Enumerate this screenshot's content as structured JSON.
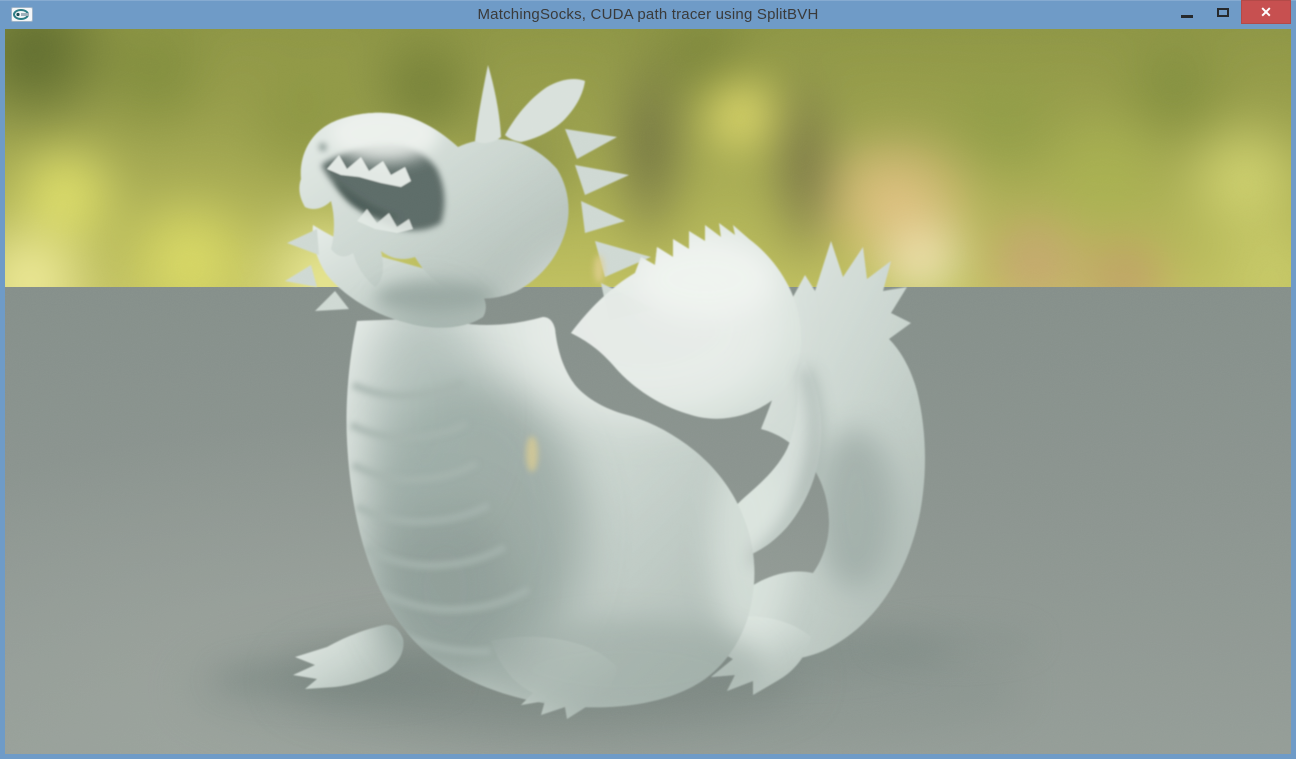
{
  "window": {
    "title": "MatchingSocks, CUDA path tracer using SplitBVH",
    "controls": {
      "minimize_label": "minimize",
      "maximize_label": "maximize",
      "close_label": "close",
      "close_glyph": "✕"
    }
  },
  "scene": {
    "description": "Path-traced white dragon statue resting on a matte gray floor in front of a blurred sunlit forest backdrop",
    "subject": "white dragon statue",
    "background": "blurred green-yellow foliage bokeh with dark tree trunks and a warm orange glow",
    "floor": "flat gray ground plane with soft contact shadows"
  },
  "colors": {
    "frame": "#6f9bc7",
    "titlebar": "#6f9bc7",
    "title_text": "#3a3a3a",
    "close_button": "#c75050",
    "close_glyph": "#ffffff",
    "floor": "#8b948f",
    "dragon": "#ccd6d1"
  }
}
